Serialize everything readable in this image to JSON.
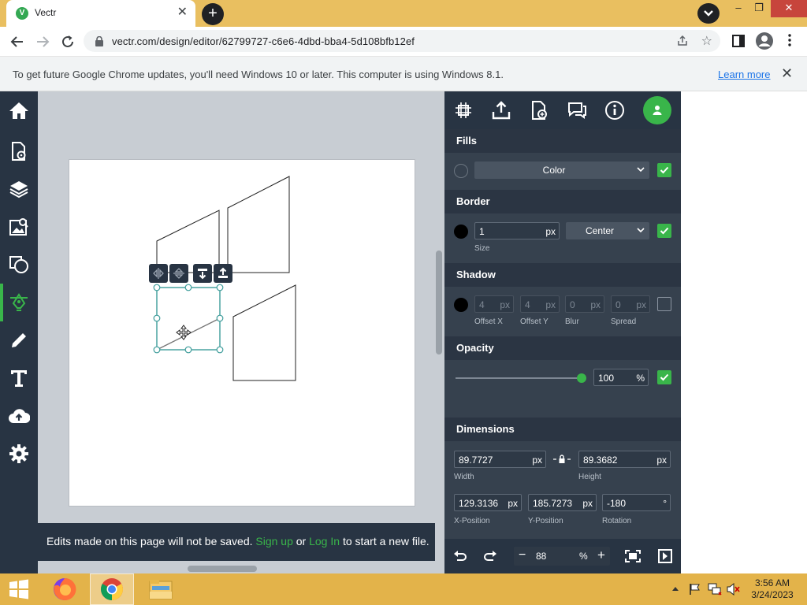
{
  "browser": {
    "tab_title": "Vectr",
    "tab_favicon_letter": "V",
    "url": "vectr.com/design/editor/62799727-c6e6-4dbd-bba4-5d108bfb12ef",
    "infobar_message": "To get future Google Chrome updates, you'll need Windows 10 or later. This computer is using Windows 8.1.",
    "infobar_link": "Learn more"
  },
  "leftbar": {
    "items": [
      {
        "icon": "home-icon"
      },
      {
        "icon": "page-settings-icon"
      },
      {
        "icon": "layers-icon"
      },
      {
        "icon": "image-search-icon"
      },
      {
        "icon": "shapes-icon"
      },
      {
        "icon": "pen-tool-icon",
        "active": true
      },
      {
        "icon": "pencil-icon"
      },
      {
        "icon": "text-icon"
      },
      {
        "icon": "cloud-upload-icon"
      },
      {
        "icon": "gear-icon"
      }
    ]
  },
  "canvas": {
    "save_notice": {
      "before": "Edits made on this page will not be saved.",
      "signup": "Sign up",
      "or": "or",
      "login": "Log In",
      "after": "to start a new file."
    }
  },
  "panel": {
    "fills": {
      "title": "Fills",
      "type": "Color"
    },
    "border": {
      "title": "Border",
      "size": "1",
      "size_unit": "px",
      "size_label": "Size",
      "position": "Center"
    },
    "shadow": {
      "title": "Shadow",
      "offset_x": "4",
      "offset_y": "4",
      "blur": "0",
      "spread": "0",
      "unit": "px",
      "labels": {
        "offset_x": "Offset X",
        "offset_y": "Offset Y",
        "blur": "Blur",
        "spread": "Spread"
      }
    },
    "opacity": {
      "title": "Opacity",
      "value": "100",
      "unit": "%"
    },
    "dimensions": {
      "title": "Dimensions",
      "width": "89.7727",
      "height": "89.3682",
      "x": "129.3136",
      "y": "185.7273",
      "rotation": "-180",
      "unit": "px",
      "rotation_unit": "°",
      "labels": {
        "width": "Width",
        "height": "Height",
        "x": "X-Position",
        "y": "Y-Position",
        "rotation": "Rotation"
      }
    },
    "zoom": {
      "value": "88",
      "unit": "%"
    }
  },
  "taskbar": {
    "time": "3:56 AM",
    "date": "3/24/2023"
  },
  "colors": {
    "accent_green": "#39b54a",
    "sidebar_dark": "#283443",
    "panel_bg": "#36414e",
    "taskbar": "#e3b34a",
    "border_color_swatch": "#000000"
  }
}
